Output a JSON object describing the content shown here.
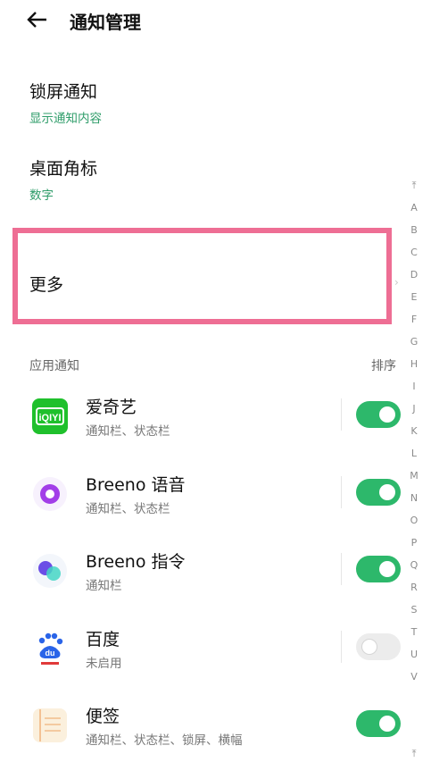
{
  "header": {
    "title": "通知管理",
    "back_icon": "back-arrow-icon"
  },
  "settings": [
    {
      "title": "锁屏通知",
      "value": "显示通知内容"
    },
    {
      "title": "桌面角标",
      "value": "数字"
    }
  ],
  "more": {
    "label": "更多"
  },
  "apps_section": {
    "label": "应用通知",
    "sort_label": "排序"
  },
  "apps": [
    {
      "name": "爱奇艺",
      "sub": "通知栏、状态栏",
      "enabled": true,
      "icon": "iqiyi-icon"
    },
    {
      "name": "Breeno 语音",
      "sub": "通知栏、状态栏",
      "enabled": true,
      "icon": "breeno-voice-icon"
    },
    {
      "name": "Breeno 指令",
      "sub": "通知栏",
      "enabled": true,
      "icon": "breeno-command-icon"
    },
    {
      "name": "百度",
      "sub": "未启用",
      "enabled": false,
      "icon": "baidu-icon"
    },
    {
      "name": "便签",
      "sub": "通知栏、状态栏、锁屏、横幅",
      "enabled": true,
      "icon": "notes-icon"
    }
  ],
  "index_bar": [
    "⤒",
    "A",
    "B",
    "C",
    "D",
    "E",
    "F",
    "G",
    "H",
    "I",
    "J",
    "K",
    "L",
    "M",
    "N",
    "O",
    "P",
    "Q",
    "R",
    "S",
    "T",
    "U",
    "V"
  ],
  "index_bottom": "⤒",
  "colors": {
    "accent": "#2db86b",
    "highlight_box": "#ee6e94",
    "subtitle_green": "#2f9d6a"
  }
}
